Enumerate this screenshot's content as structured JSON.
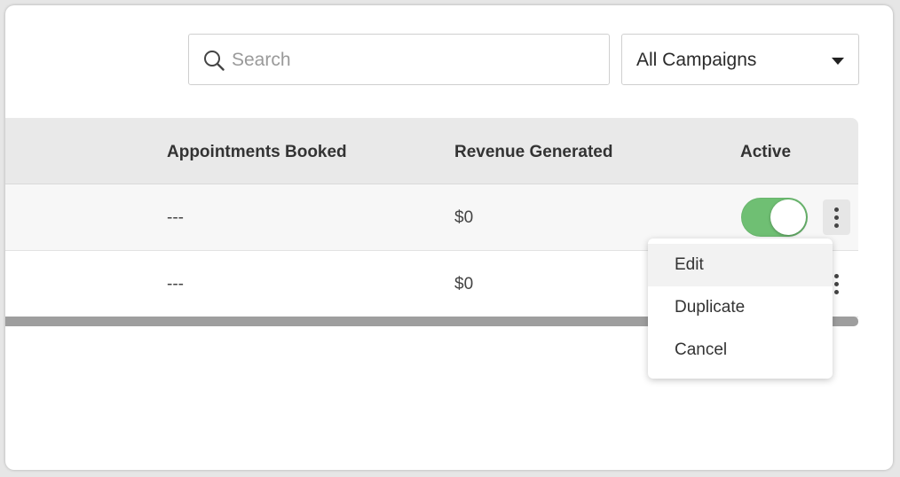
{
  "search": {
    "placeholder": "Search",
    "value": ""
  },
  "campaign_filter": {
    "selected": "All Campaigns"
  },
  "table": {
    "headers": {
      "appointments": "Appointments Booked",
      "revenue": "Revenue Generated",
      "active": "Active"
    },
    "rows": [
      {
        "appointments": "---",
        "revenue": "$0",
        "active": true
      },
      {
        "appointments": "---",
        "revenue": "$0"
      }
    ]
  },
  "context_menu": {
    "items": [
      "Edit",
      "Duplicate",
      "Cancel"
    ]
  },
  "colors": {
    "toggle_on": "#6fbf73",
    "header_bg": "#e9e9e9",
    "scrollbar": "#9e9e9e"
  }
}
